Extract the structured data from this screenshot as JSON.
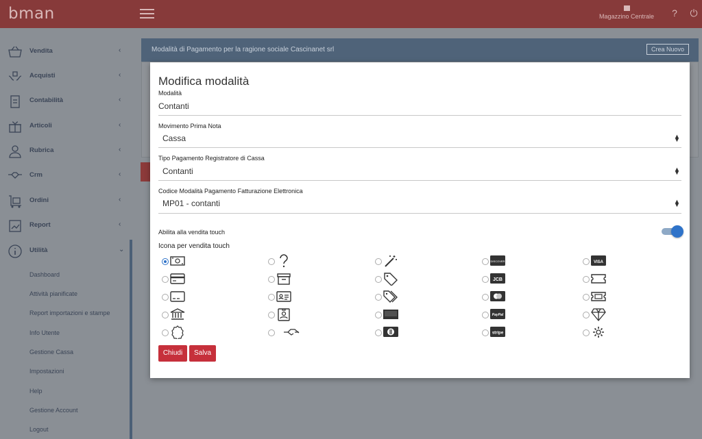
{
  "app": {
    "logo": "bman"
  },
  "topbar": {
    "store_label": "Magazzino Centrale",
    "help_icon": "question-icon",
    "power_icon": "power-icon"
  },
  "sidebar": {
    "items": [
      {
        "label": "Vendita",
        "icon": "basket-icon"
      },
      {
        "label": "Acquisti",
        "icon": "hands-money-icon"
      },
      {
        "label": "Contabilità",
        "icon": "clipboard-icon"
      },
      {
        "label": "Articoli",
        "icon": "box-icon"
      },
      {
        "label": "Rubrica",
        "icon": "person-icon"
      },
      {
        "label": "Crm",
        "icon": "handshake-icon"
      },
      {
        "label": "Ordini",
        "icon": "cart-icon"
      },
      {
        "label": "Report",
        "icon": "report-icon"
      },
      {
        "label": "Utilità",
        "icon": "info-icon"
      }
    ],
    "sub_items": [
      "Dashboard",
      "Attività pianificate",
      "Report importazioni e stampe",
      "Info Utente",
      "Gestione Cassa",
      "Impostazioni",
      "Help",
      "Gestione Account",
      "Logout"
    ]
  },
  "panel": {
    "title": "Modalità di Pagamento per la ragione sociale Cascinanet srl",
    "create_button": "Crea Nuovo"
  },
  "modal": {
    "title": "Modifica modalità",
    "modalita_label": "Modalità",
    "modalita_value": "Contanti",
    "movimento_label": "Movimento Prima Nota",
    "movimento_value": "Cassa",
    "tipo_label": "Tipo Pagamento Registratore di Cassa",
    "tipo_value": "Contanti",
    "codice_label": "Codice Modalità Pagamento Fatturazione Elettronica",
    "codice_value": "MP01 - contanti",
    "touch_label": "Abilita alla vendita touch",
    "touch_enabled": true,
    "icon_section_label": "Icona per vendita touch",
    "icons": [
      [
        "banknote-icon",
        "question-icon",
        "magic-wand-icon",
        "discover-card-icon",
        "visa-card-icon"
      ],
      [
        "credit-card-icon",
        "archive-icon",
        "tag-icon",
        "jcb-card-icon",
        "ticket-icon"
      ],
      [
        "card-outline-icon",
        "id-card-icon",
        "tags-icon",
        "mastercard-icon",
        "ticket-alt-icon"
      ],
      [
        "bank-icon",
        "badge-icon",
        "check-icon",
        "paypal-icon",
        "diamond-icon"
      ],
      [
        "certificate-icon",
        "handshake-icon",
        "diners-club-icon",
        "stripe-icon",
        "gear-icon"
      ]
    ],
    "icon_text": {
      "discover": "DISCOVER",
      "visa": "VISA",
      "jcb": "JCB",
      "paypal": "PayPal",
      "stripe": "stripe"
    },
    "close_button": "Chiudi",
    "save_button": "Salva"
  }
}
